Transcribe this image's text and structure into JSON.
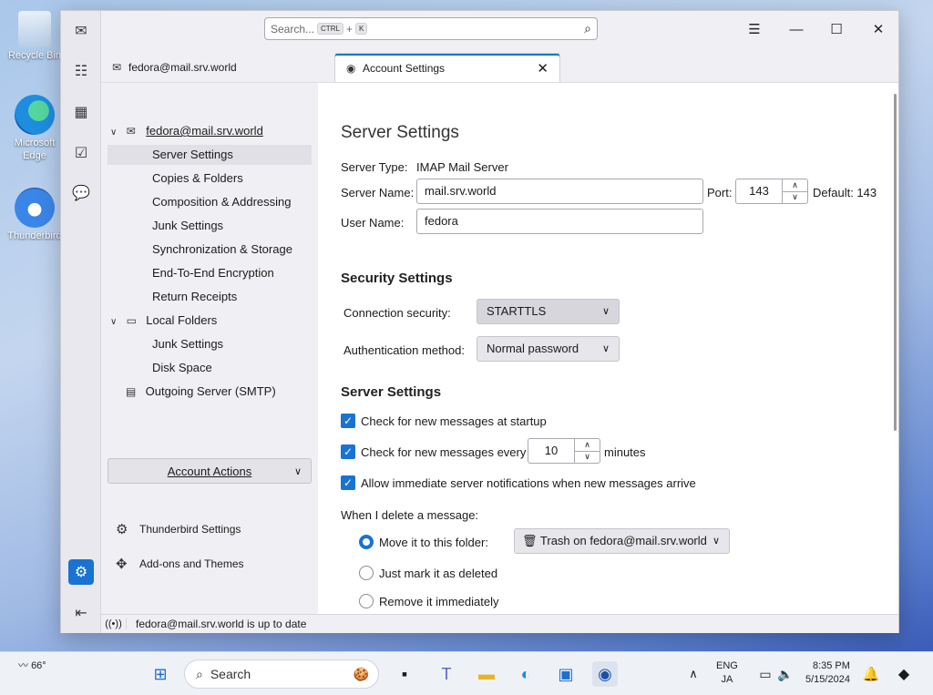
{
  "desktop": {
    "icons": [
      {
        "label": "Recycle Bin"
      },
      {
        "label": "Microsoft Edge"
      },
      {
        "label": "Thunderbird"
      }
    ]
  },
  "app": {
    "search_placeholder": "Search...",
    "search_key1": "CTRL",
    "search_plus": "+",
    "search_key2": "K",
    "tabs": [
      {
        "label": "fedora@mail.srv.world"
      },
      {
        "label": "Account Settings"
      }
    ]
  },
  "tree": {
    "account": "fedora@mail.srv.world",
    "items": [
      {
        "label": "Server Settings"
      },
      {
        "label": "Copies & Folders"
      },
      {
        "label": "Composition & Addressing"
      },
      {
        "label": "Junk Settings"
      },
      {
        "label": "Synchronization & Storage"
      },
      {
        "label": "End-To-End Encryption"
      },
      {
        "label": "Return Receipts"
      }
    ],
    "local_folders": "Local Folders",
    "local_items": [
      {
        "label": "Junk Settings"
      },
      {
        "label": "Disk Space"
      }
    ],
    "outgoing": "Outgoing Server (SMTP)",
    "account_actions": "Account Actions",
    "thunderbird_settings": "Thunderbird Settings",
    "addons": "Add-ons and Themes"
  },
  "pane": {
    "title": "Server Settings",
    "server_type_label": "Server Type:",
    "server_type_value": "IMAP Mail Server",
    "server_name_label": "Server Name:",
    "server_name_value": "mail.srv.world",
    "port_label": "Port:",
    "port_value": "143",
    "default_label": "Default: 143",
    "user_name_label": "User Name:",
    "user_name_value": "fedora",
    "security_title": "Security Settings",
    "conn_security_label": "Connection security:",
    "conn_security_value": "STARTTLS",
    "auth_label": "Authentication method:",
    "auth_value": "Normal password",
    "server_settings_title": "Server Settings",
    "check_startup": "Check for new messages at startup",
    "check_every": "Check for new messages every",
    "check_every_value": "10",
    "minutes": "minutes",
    "allow_notifications": "Allow immediate server notifications when new messages arrive",
    "delete_label": "When I delete a message:",
    "move_label": "Move it to this folder:",
    "trash_value": "Trash on fedora@mail.srv.world",
    "mark_deleted": "Just mark it as deleted",
    "remove_immediately": "Remove it immediately"
  },
  "status": {
    "text": "fedora@mail.srv.world is up to date"
  },
  "taskbar": {
    "weather": "66°",
    "search": "Search",
    "lang1": "ENG",
    "lang2": "JA",
    "time": "8:35 PM",
    "date": "5/15/2024"
  }
}
